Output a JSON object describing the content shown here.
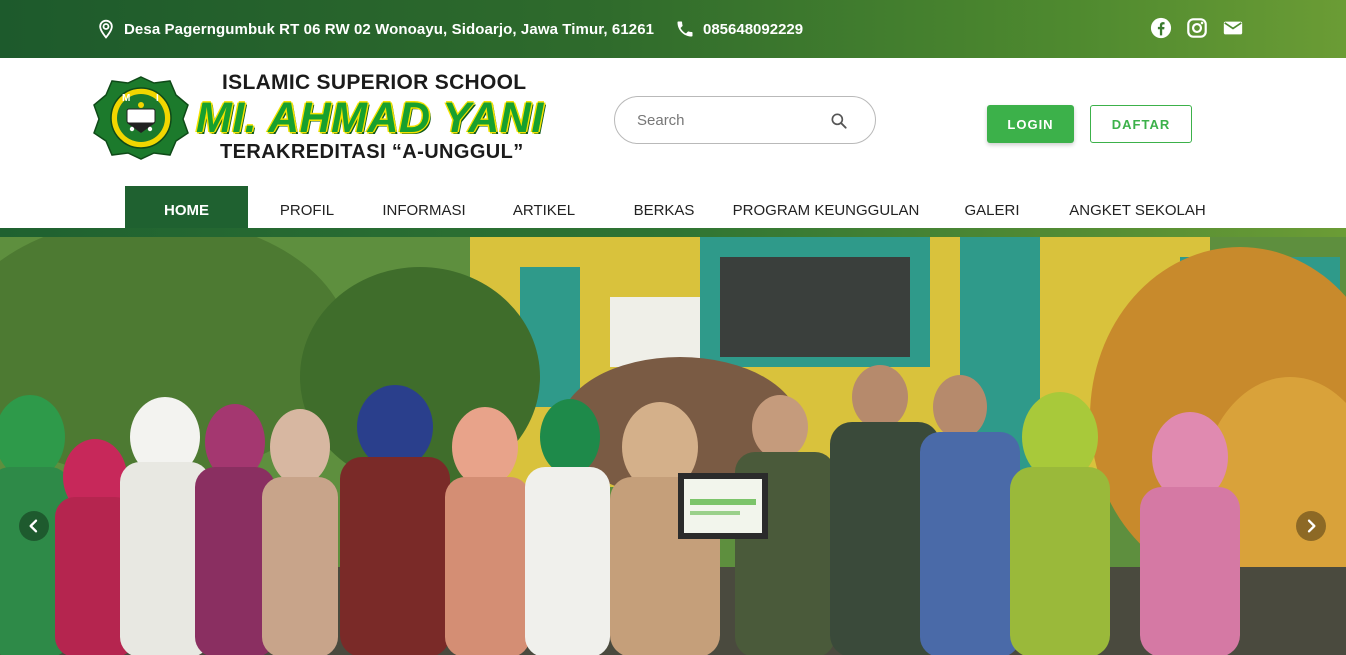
{
  "topbar": {
    "address": "Desa Pagerngumbuk RT 06 RW 02 Wonoayu, Sidoarjo, Jawa Timur, 61261",
    "phone": "085648092229",
    "icons": [
      "location-icon",
      "phone-icon",
      "facebook-icon",
      "instagram-icon",
      "mail-icon"
    ]
  },
  "brand": {
    "top_line": "ISLAMIC SUPERIOR SCHOOL",
    "name": "MI. AHMAD YANI",
    "sub_line": "TERAKREDITASI “A-UNGGUL”",
    "logo_letters": "M I"
  },
  "search": {
    "placeholder": "Search"
  },
  "auth": {
    "login_label": "LOGIN",
    "register_label": "DAFTAR"
  },
  "nav": {
    "items": [
      {
        "label": "HOME",
        "active": true
      },
      {
        "label": "PROFIL"
      },
      {
        "label": "INFORMASI"
      },
      {
        "label": "ARTIKEL"
      },
      {
        "label": "BERKAS"
      },
      {
        "label": "PROGRAM KEUNGGULAN"
      },
      {
        "label": "GALERI"
      },
      {
        "label": "ANGKET SEKOLAH"
      }
    ]
  },
  "hero": {
    "slider_prev": "chevron-left-icon",
    "slider_next": "chevron-right-icon"
  },
  "colors": {
    "primary_green": "#1f6130",
    "accent_green": "#3cb14a",
    "brand_yellow": "#f5e200"
  }
}
